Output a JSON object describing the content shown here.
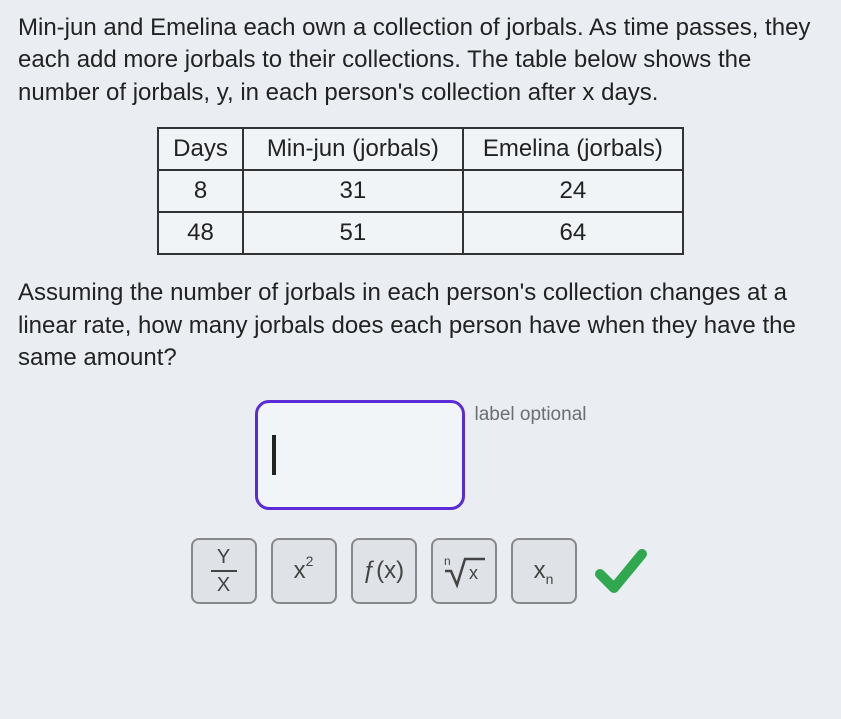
{
  "prompt1": "Min-jun and Emelina each own a collection of jorbals. As time passes, they each add more jorbals to their collections. The table below shows the number of jorbals, y, in each person's collection after x days.",
  "table": {
    "headers": [
      "Days",
      "Min-jun (jorbals)",
      "Emelina (jorbals)"
    ],
    "rows": [
      [
        "8",
        "31",
        "24"
      ],
      [
        "48",
        "51",
        "64"
      ]
    ]
  },
  "prompt2": "Assuming the number of jorbals in each person's collection changes at a linear rate, how many jorbals does each person have when they have the same amount?",
  "answer": {
    "value": "",
    "label": "label optional"
  },
  "tools": {
    "fraction_top": "Y",
    "fraction_bottom": "X",
    "power_base": "x",
    "power_exp": "2",
    "function": "ƒ(x)",
    "root_index": "n",
    "root_radicand": "x",
    "subscript_base": "x",
    "subscript_sub": "n"
  }
}
